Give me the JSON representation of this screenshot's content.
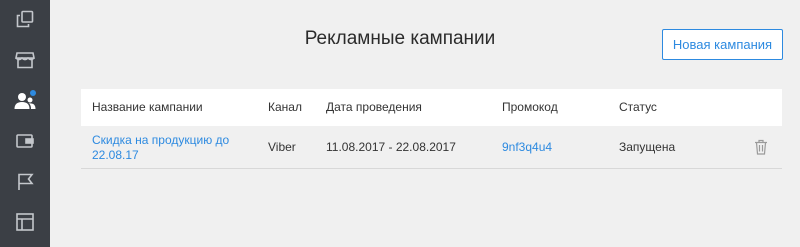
{
  "sidebar": {
    "items": [
      {
        "icon": "copy-icon"
      },
      {
        "icon": "store-icon"
      },
      {
        "icon": "users-icon",
        "active": true
      },
      {
        "icon": "wallet-icon"
      },
      {
        "icon": "flag-icon"
      },
      {
        "icon": "layout-icon"
      }
    ]
  },
  "page": {
    "title": "Рекламные кампании",
    "new_campaign_button": "Новая кампания"
  },
  "table": {
    "columns": [
      "Название кампании",
      "Канал",
      "Дата проведения",
      "Промокод",
      "Статус"
    ],
    "rows": [
      {
        "name_line1": "Скидка на продукцию до",
        "name_line2": "22.08.17",
        "channel": "Viber",
        "dates": "11.08.2017 - 22.08.2017",
        "promo": "9nf3q4u4",
        "status": "Запущена"
      }
    ]
  },
  "colors": {
    "accent": "#2d8ae0",
    "sidebar_bg": "#3b3f45",
    "page_bg": "#f0f0f0"
  }
}
